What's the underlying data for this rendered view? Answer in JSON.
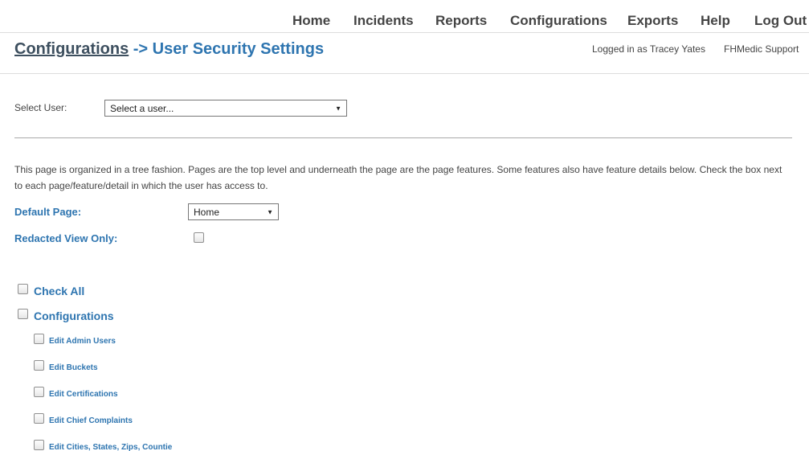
{
  "nav": {
    "home": "Home",
    "incidents": "Incidents",
    "reports": "Reports",
    "configurations": "Configurations",
    "exports": "Exports",
    "help": "Help",
    "logout": "Log Out"
  },
  "header": {
    "title_link": "Configurations",
    "title_rest": " -> User Security Settings",
    "logged_in": "Logged in as Tracey Yates",
    "support": "FHMedic Support"
  },
  "form": {
    "select_user_label": "Select User:",
    "select_user_value": "Select a user...",
    "instructions": "This page is organized in a tree fashion. Pages are the top level and underneath the page are the page features. Some features also have feature details below. Check the box next to each page/feature/detail in which the user has access to.",
    "default_page_label": "Default Page:",
    "default_page_value": "Home",
    "redacted_label": "Redacted View Only:"
  },
  "tree": {
    "check_all": "Check All",
    "configurations": "Configurations",
    "features": [
      "Edit Admin Users",
      "Edit Buckets",
      "Edit Certifications",
      "Edit Chief Complaints",
      "Edit Cities, States, Zips, Countie"
    ]
  },
  "colors": {
    "accent": "#2e75b0",
    "nav_text": "#444444",
    "title_link": "#3d4f5f"
  }
}
